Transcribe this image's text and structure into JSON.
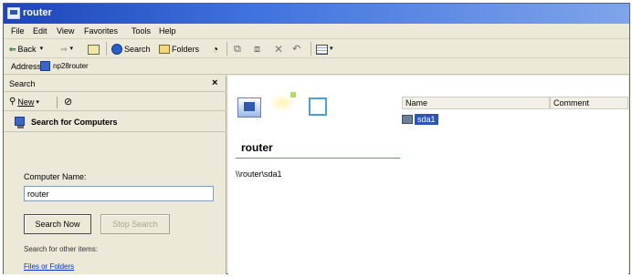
{
  "window": {
    "title": "router"
  },
  "menu": [
    "File",
    "Edit",
    "View",
    "Favorites",
    "Tools",
    "Help"
  ],
  "toolbar": {
    "back_label": "Back",
    "search_label": "Search",
    "folders_label": "Folders"
  },
  "address": {
    "label": "Address",
    "value": "np28router"
  },
  "search_pane": {
    "title": "Search",
    "close": "×",
    "new_label": "New",
    "section_title": "Search for Computers",
    "computer_name_label": "Computer Name:",
    "computer_name_value": "router",
    "search_now_label": "Search Now",
    "stop_search_label": "Stop Search",
    "other_items_label": "Search for other items:",
    "files_or_folders_link": "Files or Folders"
  },
  "content": {
    "folder_title": "router",
    "path": "\\\\router\\sda1",
    "columns": [
      "Name",
      "Comment"
    ],
    "items": [
      {
        "name": "sda1"
      }
    ]
  },
  "colors": {
    "titlebar": "#1d45b8",
    "selection": "#2a54b8",
    "link": "#0033cc"
  }
}
